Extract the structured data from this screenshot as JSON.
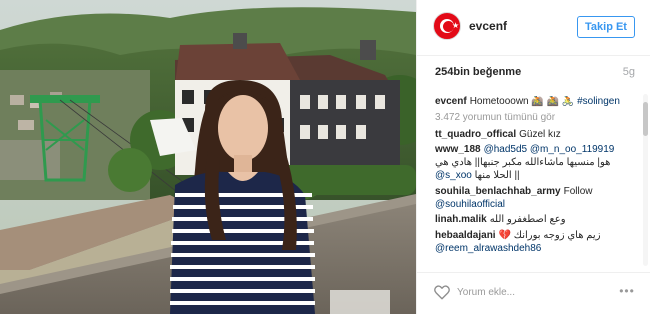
{
  "post": {
    "username": "evcenf",
    "follow_label": "Takip Et",
    "likes": "254bin beğenme",
    "time": "5g",
    "caption": {
      "user": "evcenf",
      "text": "Hometooown 🚵 🚵 🚴 ",
      "hashtag": "#solingen"
    },
    "view_all": "3.472 yorumun tümünü gör",
    "comments": [
      {
        "user": "tt_quadro_offical",
        "text": "Güzel kız"
      },
      {
        "user": "www_188",
        "mentions": "@had5d5 @m_n_oo_119919",
        "text": "هو| منسيها ماشاءالله مكبر جنبها|| هادي هي",
        "mention2": "@s_xoo",
        "text2": "|| الحلا منها"
      },
      {
        "user": "souhila_benlachhab_army",
        "text": "Follow",
        "mention": "@souhilaofficial"
      },
      {
        "user": "linah.malik",
        "text": "وعع اصطغفرو الله"
      },
      {
        "user": "hebaaldajani",
        "text": "زيم هاي زوجه بورانك 💔",
        "mention": "@reem_alrawashdeh86"
      }
    ],
    "comment_placeholder": "Yorum ekle...",
    "more_label": "•••"
  },
  "colors": {
    "accent": "#3897f0",
    "link": "#003569",
    "muted": "#999999",
    "avatar_red": "#e30a17"
  },
  "icons": {
    "heart": "heart-outline-icon",
    "more": "more-options-icon"
  }
}
